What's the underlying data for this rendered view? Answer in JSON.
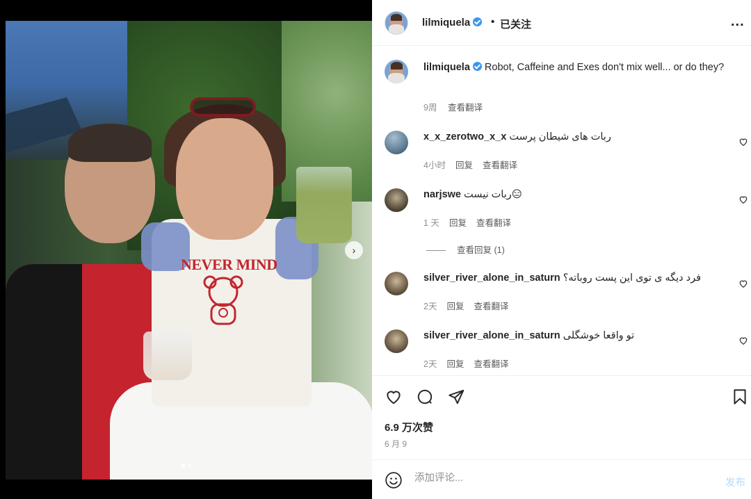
{
  "post": {
    "dots": [
      true,
      false
    ],
    "shirt_text": "NEVER MIND"
  },
  "header": {
    "username": "lilmiquela",
    "separator": "•",
    "follow_status": "已关注",
    "more": "..."
  },
  "caption": {
    "username": "lilmiquela",
    "text": "Robot, Caffeine and Exes don't mix well... or do they?",
    "age": "9周",
    "translate": "查看翻译"
  },
  "comments": [
    {
      "username": "x_x_zerotwo_x_x",
      "text": "ربات های شیطان پرست",
      "age": "4小时",
      "reply": "回复",
      "translate": "查看翻译"
    },
    {
      "username": "narjswe",
      "text": "ربات نیست😑",
      "age": "1 天",
      "reply": "回复",
      "translate": "查看翻译",
      "view_replies": "查看回复 (1)"
    },
    {
      "username": "silver_river_alone_in_saturn",
      "text": "فرد دیگه ی توی این پست روباته؟",
      "age": "2天",
      "reply": "回复",
      "translate": "查看翻译"
    },
    {
      "username": "silver_river_alone_in_saturn",
      "text": "تو واقعا خوشگلی",
      "age": "2天",
      "reply": "回复",
      "translate": "查看翻译"
    }
  ],
  "actions": {
    "likes": "6.9 万次赞",
    "date": "6 月 9"
  },
  "comment_box": {
    "placeholder": "添加评论...",
    "post_label": "发布"
  },
  "colors": {
    "verified": "#3897f0",
    "muted": "#8e8e8e",
    "post_disabled": "#b3dbff"
  }
}
